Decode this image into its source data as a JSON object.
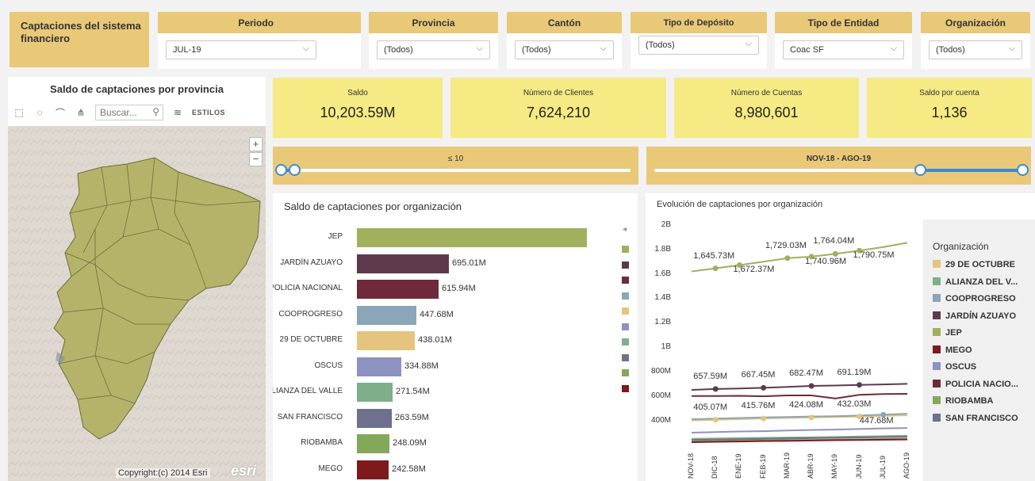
{
  "app_title": "Captaciones del sistema financiero",
  "filters": [
    {
      "label": "Periodo",
      "value": "JUL-19"
    },
    {
      "label": "Provincia",
      "value": "(Todos)"
    },
    {
      "label": "Cantón",
      "value": "(Todos)"
    },
    {
      "label": "Tipo de Depósito",
      "value": "(Todos)"
    },
    {
      "label": "Tipo de Entidad",
      "value": "Coac SF"
    },
    {
      "label": "Organización",
      "value": "(Todos)"
    }
  ],
  "map": {
    "title": "Saldo de captaciones por provincia",
    "search_placeholder": "Buscar...",
    "styles_label": "ESTILOS",
    "zoom_in": "+",
    "zoom_out": "−",
    "copyright": "Copyright:(c) 2014 Esri",
    "logo": "esri",
    "fill_color": "#b5b36a"
  },
  "kpis": [
    {
      "label": "Saldo",
      "value": "10,203.59M"
    },
    {
      "label": "Número de Clientes",
      "value": "7,624,210"
    },
    {
      "label": "Número de Cuentas",
      "value": "8,980,601"
    },
    {
      "label": "Saldo por cuenta",
      "value": "1,136"
    }
  ],
  "sliders": [
    {
      "label": "≤ 10",
      "range": [
        0.0,
        0.04
      ]
    },
    {
      "label": "NOV-18 - AGO-19",
      "range": [
        0.72,
        1.0
      ]
    }
  ],
  "bar_chart": {
    "title": "Saldo de captaciones por organización",
    "chart_data": {
      "type": "bar",
      "orientation": "horizontal",
      "categories": [
        "JEP",
        "JARDÍN AZUAYO",
        "POLICIA NACIONAL",
        "COOPROGRESO",
        "29 DE OCTUBRE",
        "OSCUS",
        "ALIANZA DEL VALLE",
        "SAN FRANCISCO",
        "RIOBAMBA",
        "MEGO"
      ],
      "values": [
        1740,
        695.01,
        615.94,
        447.68,
        438.01,
        334.88,
        271.54,
        263.59,
        248.09,
        242.58
      ],
      "value_labels": [
        "",
        "695.01M",
        "615.94M",
        "447.68M",
        "438.01M",
        "334.88M",
        "271.54M",
        "263.59M",
        "248.09M",
        "242.58M"
      ],
      "colors": [
        "#a0b05c",
        "#5c3a4c",
        "#6e2a3a",
        "#8aa6b8",
        "#e4c47e",
        "#8d92c0",
        "#7eaf8a",
        "#6f6f8e",
        "#83a85a",
        "#7e1a1e"
      ]
    },
    "legend_colors": [
      "#a0b05c",
      "#5c3a4c",
      "#6e2a3a",
      "#8aa6b8",
      "#e4c47e",
      "#8d92c0",
      "#7eaf8a",
      "#6f6f8e",
      "#83a85a",
      "#7e1a1e"
    ],
    "legend_arrow": "◄"
  },
  "line_chart": {
    "title": "Evolución de captaciones por organización",
    "chart_data": {
      "type": "line",
      "x": [
        "NOV-18",
        "DIC-18",
        "ENE-19",
        "FEB-19",
        "MAR-19",
        "ABR-19",
        "MAY-19",
        "JUN-19",
        "JUL-19",
        "AGO-19"
      ],
      "y_ticks": [
        "2B",
        "1.8B",
        "1.6B",
        "1.4B",
        "1.2B",
        "1B",
        "800M",
        "600M",
        "400M"
      ],
      "ylim": [
        300,
        2000
      ],
      "series": [
        {
          "name": "JEP",
          "color": "#a0b05c",
          "values": [
            1620,
            1645.73,
            1672.37,
            1700,
            1729.03,
            1740.96,
            1764.04,
            1790.75,
            1820,
            1855
          ]
        },
        {
          "name": "JARDÍN AZUAYO",
          "color": "#5c3a4c",
          "values": [
            650,
            657.59,
            662,
            667.45,
            675,
            682.47,
            686,
            691.19,
            695.01,
            700
          ]
        },
        {
          "name": "POLICIA NACIONAL",
          "color": "#6e2a3a",
          "values": [
            600,
            600,
            602,
            598,
            605,
            605,
            580,
            610,
            615.94,
            618
          ]
        },
        {
          "name": "29 DE OCTUBRE",
          "color": "#e4c47e",
          "values": [
            400,
            405.07,
            410,
            415.76,
            420,
            424.08,
            428,
            432.03,
            438.01,
            442
          ]
        },
        {
          "name": "COOPROGRESO",
          "color": "#8aa6b8",
          "values": [
            410,
            415,
            420,
            425,
            428,
            432,
            435,
            440,
            447.68,
            455
          ]
        },
        {
          "name": "OSCUS",
          "color": "#8d92c0",
          "values": [
            300,
            305,
            310,
            312,
            318,
            322,
            325,
            330,
            334.88,
            338
          ]
        },
        {
          "name": "ALIANZA DEL VALLE",
          "color": "#7eaf8a",
          "values": [
            250,
            252,
            255,
            258,
            260,
            262,
            265,
            268,
            271.54,
            275
          ]
        },
        {
          "name": "SAN FRANCISCO",
          "color": "#6f6f8e",
          "values": [
            240,
            243,
            246,
            249,
            252,
            255,
            258,
            261,
            263.59,
            266
          ]
        },
        {
          "name": "RIOBAMBA",
          "color": "#83a85a",
          "values": [
            228,
            230,
            233,
            236,
            239,
            241,
            243,
            246,
            248.09,
            250
          ]
        },
        {
          "name": "MEGO",
          "color": "#7e1a1e",
          "values": [
            222,
            225,
            228,
            231,
            233,
            236,
            238,
            240,
            242.58,
            244
          ]
        }
      ],
      "point_labels": [
        {
          "series": "JEP",
          "index": 1,
          "text": "1,645.73M"
        },
        {
          "series": "JEP",
          "index": 2,
          "text": "1,672.37M"
        },
        {
          "series": "JEP",
          "index": 4,
          "text": "1,729.03M"
        },
        {
          "series": "JEP",
          "index": 5,
          "text": "1,740.96M"
        },
        {
          "series": "JEP",
          "index": 6,
          "text": "1,764.04M"
        },
        {
          "series": "JEP",
          "index": 7,
          "text": "1,790.75M"
        },
        {
          "series": "JARDÍN AZUAYO",
          "index": 1,
          "text": "657.59M"
        },
        {
          "series": "JARDÍN AZUAYO",
          "index": 3,
          "text": "667.45M"
        },
        {
          "series": "JARDÍN AZUAYO",
          "index": 5,
          "text": "682.47M"
        },
        {
          "series": "JARDÍN AZUAYO",
          "index": 7,
          "text": "691.19M"
        },
        {
          "series": "29 DE OCTUBRE",
          "index": 1,
          "text": "405.07M"
        },
        {
          "series": "29 DE OCTUBRE",
          "index": 3,
          "text": "415.76M"
        },
        {
          "series": "29 DE OCTUBRE",
          "index": 5,
          "text": "424.08M"
        },
        {
          "series": "29 DE OCTUBRE",
          "index": 7,
          "text": "432.03M"
        },
        {
          "series": "COOPROGRESO",
          "index": 8,
          "text": "447.68M"
        }
      ]
    },
    "legend_title": "Organización",
    "legend": [
      {
        "name": "29 DE OCTUBRE",
        "color": "#e4c47e"
      },
      {
        "name": "ALIANZA DEL V...",
        "color": "#7eaf8a"
      },
      {
        "name": "COOPROGRESO",
        "color": "#8aa6b8"
      },
      {
        "name": "JARDÍN AZUAYO",
        "color": "#5c3a4c"
      },
      {
        "name": "JEP",
        "color": "#a0b05c"
      },
      {
        "name": "MEGO",
        "color": "#7e1a1e"
      },
      {
        "name": "OSCUS",
        "color": "#8d92c0"
      },
      {
        "name": "POLICIA NACIO...",
        "color": "#6e2a3a"
      },
      {
        "name": "RIOBAMBA",
        "color": "#83a85a"
      },
      {
        "name": "SAN FRANCISCO",
        "color": "#6f6f8e"
      }
    ]
  }
}
